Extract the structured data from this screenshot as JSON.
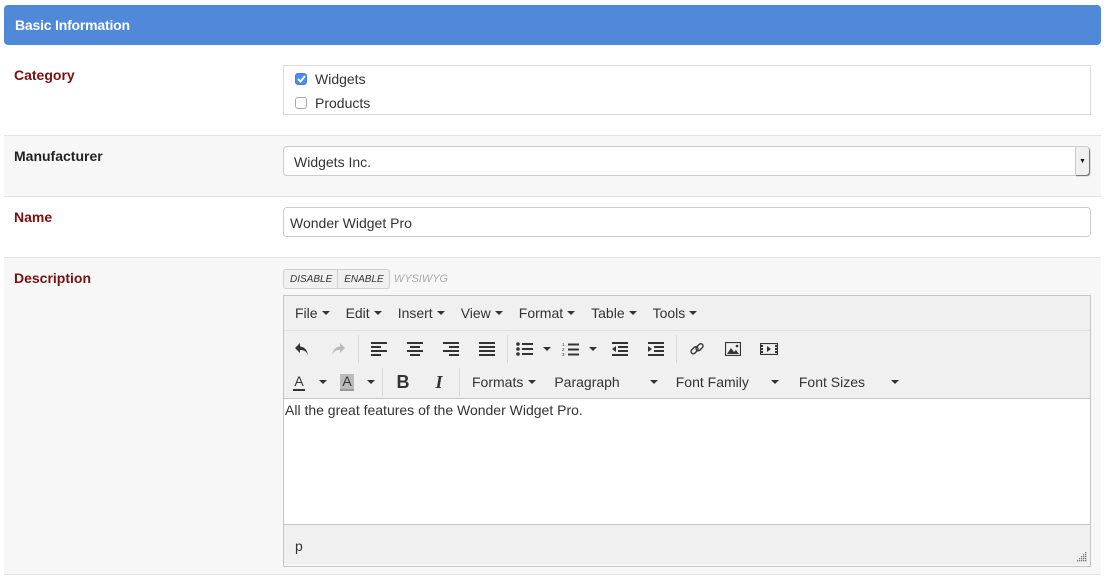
{
  "panel": {
    "title": "Basic Information",
    "accent_color": "#5189d9"
  },
  "fields": {
    "category": {
      "label": "Category",
      "required": true,
      "options": [
        {
          "label": "Widgets",
          "checked": true
        },
        {
          "label": "Products",
          "checked": false
        }
      ]
    },
    "manufacturer": {
      "label": "Manufacturer",
      "required": false,
      "selected": "Widgets Inc."
    },
    "name": {
      "label": "Name",
      "required": true,
      "value": "Wonder Widget Pro"
    },
    "description": {
      "label": "Description",
      "required": true,
      "wysiwyg_toggle": {
        "disable": "DISABLE",
        "enable": "ENABLE",
        "note": "WYSIWYG"
      },
      "editor": {
        "menus": [
          "File",
          "Edit",
          "Insert",
          "View",
          "Format",
          "Table",
          "Tools"
        ],
        "toolbar_row1_icons": [
          "undo-icon",
          "redo-icon",
          "align-left-icon",
          "align-center-icon",
          "align-right-icon",
          "align-justify-icon",
          "bullet-list-icon",
          "numbered-list-icon",
          "outdent-icon",
          "indent-icon",
          "link-icon",
          "image-icon",
          "media-icon"
        ],
        "dropdowns": {
          "formats": "Formats",
          "block": "Paragraph",
          "font_family": "Font Family",
          "font_sizes": "Font Sizes"
        },
        "bold_label": "B",
        "italic_label": "I",
        "text_color_label": "A",
        "bg_color_label": "A",
        "content": "All the great features of the Wonder Widget Pro.",
        "status_path": "p"
      }
    }
  },
  "colors": {
    "required_label": "#7a1010",
    "optional_label": "#222222"
  }
}
